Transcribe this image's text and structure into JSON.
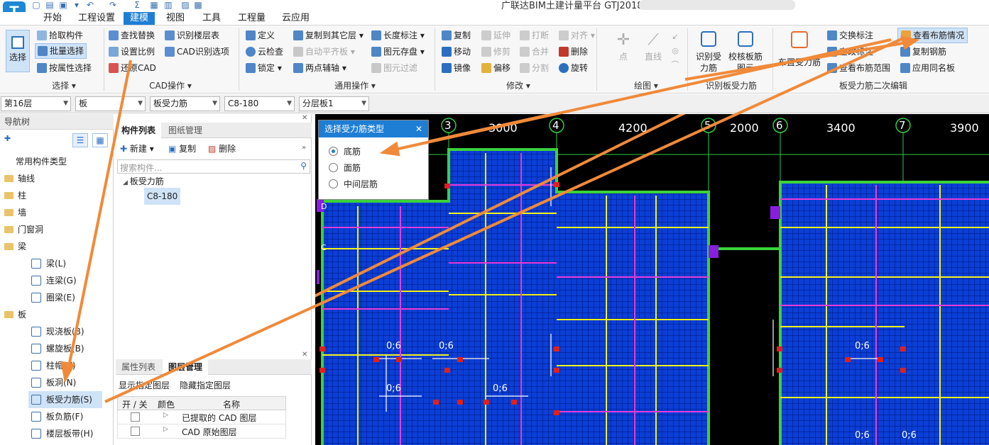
{
  "app": {
    "title": "广联达BIM土建计量平台 GTJ2018 -",
    "logo_letter": "T"
  },
  "menu": {
    "tabs": [
      "开始",
      "工程设置",
      "建模",
      "视图",
      "工具",
      "工程量",
      "云应用"
    ],
    "active": "建模"
  },
  "ribbon": {
    "select_label": "选择",
    "groups": {
      "select": {
        "label": "选择",
        "items": [
          "拾取构件",
          "批量选择",
          "按属性选择"
        ]
      },
      "cad": {
        "label": "CAD操作",
        "items": [
          "查找替换",
          "识别楼层表",
          "设置比例",
          "CAD识别选项",
          "还原CAD"
        ]
      },
      "common": {
        "label": "通用操作",
        "items": [
          "定义",
          "复制到其它层",
          "长度标注",
          "云检查",
          "自动平齐板",
          "图元存盘",
          "锁定",
          "两点辅轴",
          "图元过滤"
        ]
      },
      "modify": {
        "label": "修改",
        "items": [
          "复制",
          "延伸",
          "打断",
          "对齐",
          "移动",
          "修剪",
          "合并",
          "删除",
          "镜像",
          "偏移",
          "分割",
          "旋转"
        ]
      },
      "draw": {
        "label": "绘图",
        "items": [
          "点",
          "直线"
        ]
      },
      "identify": {
        "label": "识别板受力筋",
        "items": [
          "识别受力筋",
          "校核板筋图元"
        ]
      },
      "edit2": {
        "label": "板受力筋二次编辑",
        "items": [
          "布置受力筋",
          "交换标注",
          "查看布筋情况",
          "查改标注",
          "复制钢筋",
          "查看布筋范围",
          "应用同名板"
        ]
      }
    }
  },
  "toolbar2": {
    "floor": "第16层",
    "category": "板",
    "type": "板受力筋",
    "component": "C8-180",
    "layer": "分层板1"
  },
  "nav": {
    "title": "导航树",
    "common": "常用构件类型",
    "folders": [
      "轴线",
      "柱",
      "墙",
      "门窗洞",
      "梁"
    ],
    "beam_items": [
      "梁(L)",
      "连梁(G)",
      "圈梁(E)"
    ],
    "slab_folder": "板",
    "slab_items": [
      "现浇板(B)",
      "螺旋板(B)",
      "柱帽(V)",
      "板洞(N)",
      "板受力筋(S)",
      "板负筋(F)",
      "楼层板带(H)"
    ]
  },
  "component_list": {
    "tabs": [
      "构件列表",
      "图纸管理"
    ],
    "new": "新建",
    "copy": "复制",
    "delete": "删除",
    "search_placeholder": "搜索构件...",
    "tree_root": "板受力筋",
    "tree_item": "C8-180"
  },
  "property_list": {
    "tabs": [
      "属性列表",
      "图层管理"
    ],
    "show": "显示指定图层",
    "hide": "隐藏指定图层",
    "cols": [
      "开 / 关",
      "颜色",
      "名称"
    ],
    "rows": [
      "已提取的 CAD 图层",
      "CAD 原始图层"
    ]
  },
  "dialog": {
    "title": "选择受力筋类型",
    "options": [
      "底筋",
      "面筋",
      "中间层筋"
    ],
    "selected": "底筋"
  },
  "canvas": {
    "axis_labels": [
      "3",
      "4",
      "5",
      "6",
      "7"
    ],
    "spans": [
      "3000",
      "4200",
      "2000",
      "3400",
      "3900"
    ],
    "rebar_label": "0;6",
    "row_labels": [
      "D",
      "C"
    ]
  },
  "colors": {
    "accent": "#1e7ed4",
    "slab": "#0b3fd6",
    "rebar_yellow": "#f2f21a",
    "rebar_magenta": "#e83ad8",
    "wall_green": "#3ad23a",
    "arrow": "#f08a3a"
  }
}
